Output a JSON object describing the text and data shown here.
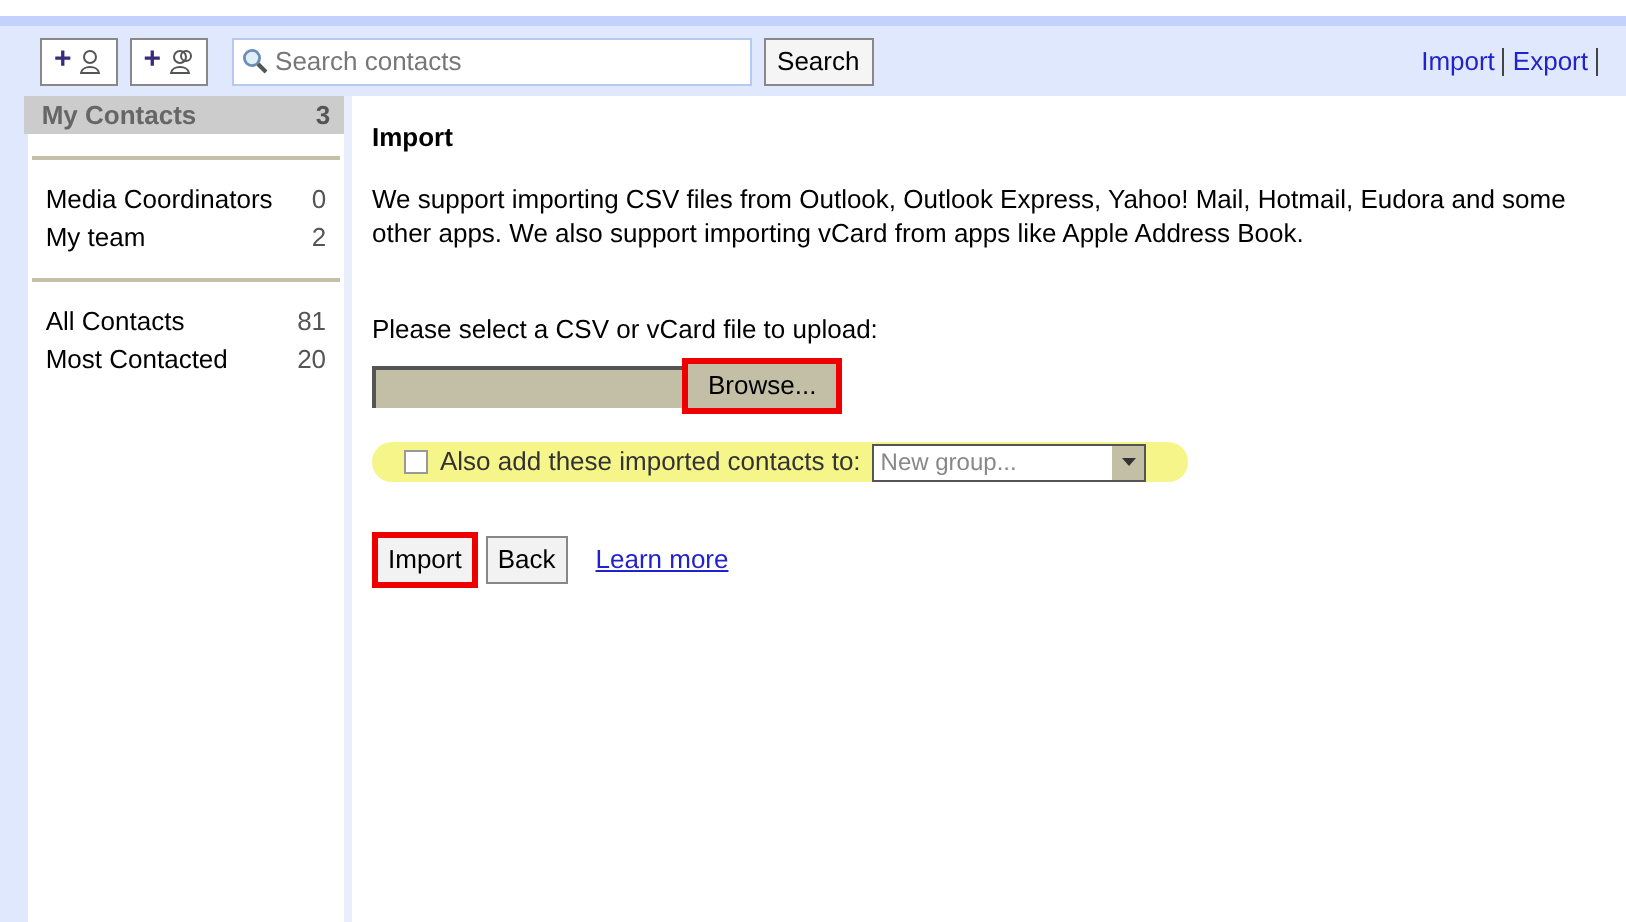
{
  "toolbar": {
    "add_buttons": [
      {
        "kind": "contact",
        "label": "+"
      },
      {
        "kind": "group",
        "label": "+"
      }
    ],
    "search": {
      "placeholder": "Search contacts"
    },
    "search_button": "Search",
    "links": [
      "Import",
      "Export"
    ]
  },
  "sidebar": {
    "sections": [
      {
        "items": [
          {
            "label": "My Contacts",
            "count": "3",
            "selected": true
          }
        ]
      },
      {
        "items": [
          {
            "label": "Media Coordinators",
            "count": "0",
            "selected": false
          },
          {
            "label": "My team",
            "count": "2",
            "selected": false
          }
        ]
      },
      {
        "items": [
          {
            "label": "All Contacts",
            "count": "81",
            "selected": false
          },
          {
            "label": "Most Contacted",
            "count": "20",
            "selected": false
          }
        ]
      }
    ]
  },
  "main": {
    "title": "Import",
    "description": "We support importing CSV files from Outlook, Outlook Express, Yahoo! Mail, Hotmail, Eudora and some other apps. We also support importing vCard from apps like Apple Address Book.",
    "file_label": "Please select a CSV or vCard file to upload:",
    "browse_button": {
      "label": "Browse...",
      "annotated": true
    },
    "group_option": {
      "label": "Also add these imported contacts to:",
      "checked": false,
      "highlighted": true,
      "select_value": "New group..."
    },
    "buttons": [
      {
        "label": "Import",
        "annotated": true
      },
      {
        "label": "Back",
        "annotated": false
      }
    ],
    "learn_more": "Learn more"
  }
}
